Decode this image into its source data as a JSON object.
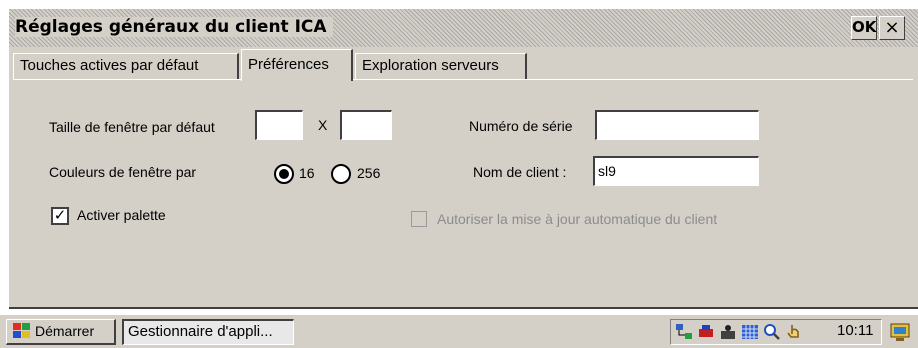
{
  "window": {
    "title": "Réglages généraux du client ICA",
    "ok_label": "OK",
    "close_label": "×"
  },
  "tabs": [
    {
      "label": "Touches actives par défaut",
      "active": false
    },
    {
      "label": "Préférences",
      "active": true
    },
    {
      "label": "Exploration serveurs",
      "active": false
    }
  ],
  "prefs": {
    "window_size_label": "Taille de fenêtre par défaut",
    "width_value": "",
    "x_separator": "X",
    "height_value": "",
    "colors_label": "Couleurs de fenêtre par",
    "color_options": [
      {
        "label": "16",
        "selected": true
      },
      {
        "label": "256",
        "selected": false
      }
    ],
    "activate_palette_label": "Activer palette",
    "activate_palette_checked": true,
    "serial_label": "Numéro de série",
    "serial_value": "",
    "client_name_label": "Nom de client :",
    "client_name_value": "sl9",
    "auto_update_label": "Autoriser la mise à jour automatique du client",
    "auto_update_checked": false,
    "auto_update_enabled": false
  },
  "taskbar": {
    "start_label": "Démarrer",
    "task_label": "Gestionnaire d'appli...",
    "clock": "10:11"
  },
  "icons": {
    "start": "windows-logo-icon",
    "tray": [
      "network-icon",
      "pc-card-icon",
      "sound-icon",
      "keyboard-icon",
      "search-icon",
      "touch-icon"
    ],
    "corner": "desktop-icon"
  },
  "colors": {
    "face": "#d4d0c8",
    "shadow": "#404040",
    "highlight": "#ffffff",
    "disabled": "#8c8c8c"
  }
}
